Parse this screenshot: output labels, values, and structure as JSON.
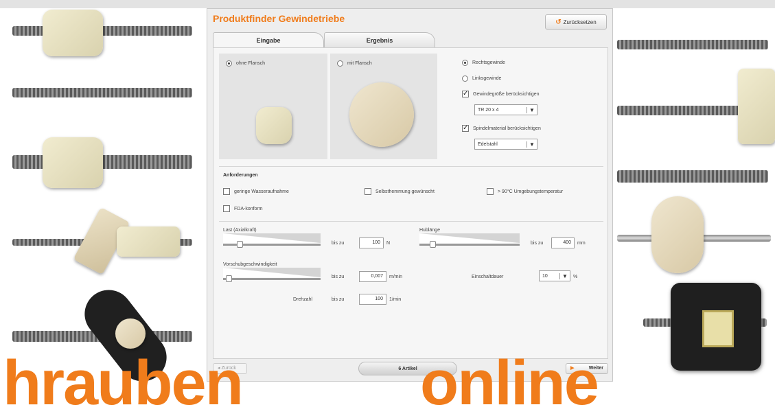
{
  "app": {
    "title": "Produktfinder Gewindetriebe",
    "reset_label": "Zurücksetzen",
    "tabs": [
      {
        "label": "Eingabe"
      },
      {
        "label": "Ergebnis"
      }
    ]
  },
  "flange": {
    "without_label": "ohne Flansch",
    "with_label": "mit Flansch",
    "selected": "ohne Flansch"
  },
  "thread": {
    "right_label": "Rechtsgewinde",
    "left_label": "Linksgewinde",
    "selected": "Rechtsgewinde",
    "size_checkbox_label": "Gewindegröße berücksichtigen",
    "size_value": "TR 20 x 4",
    "material_checkbox_label": "Spindelmaterial berücksichtigen",
    "material_value": "Edelstahl"
  },
  "requirements": {
    "title": "Anforderungen",
    "items": [
      {
        "label": "geringe Wasseraufnahme",
        "checked": false
      },
      {
        "label": "Selbsthemmung gewünscht",
        "checked": false
      },
      {
        "label": "> 90°C Umgebungstemperatur",
        "checked": false
      },
      {
        "label": "FDA-konform",
        "checked": false
      }
    ]
  },
  "params": {
    "load_label": "Last (Axialkraft)",
    "upto": "bis zu",
    "load_value": "100",
    "load_unit": "N",
    "stroke_label": "Hublänge",
    "stroke_upto": "bis zu",
    "stroke_value": "400",
    "stroke_unit": "mm",
    "speed_label": "Vorschubgeschwindigkeit",
    "speed_upto": "bis zu",
    "speed_value": "0,007",
    "speed_unit": "m/min",
    "duty_label": "Einschaltdauer",
    "duty_value": "10",
    "duty_unit": "%",
    "rpm_label": "Drehzahl",
    "rpm_upto": "bis zu",
    "rpm_value": "100",
    "rpm_unit": "1/min",
    "load_slider_level": 0.12,
    "stroke_slider_level": 0.08,
    "speed_slider_level": 0.0
  },
  "footer": {
    "back_label": "Zurück",
    "articles_label": "6 Artikel",
    "next_label": "Weiter"
  },
  "banner": {
    "left_text": "hrauben",
    "right_text": "online"
  },
  "colors": {
    "accent": "#f07c1b"
  }
}
